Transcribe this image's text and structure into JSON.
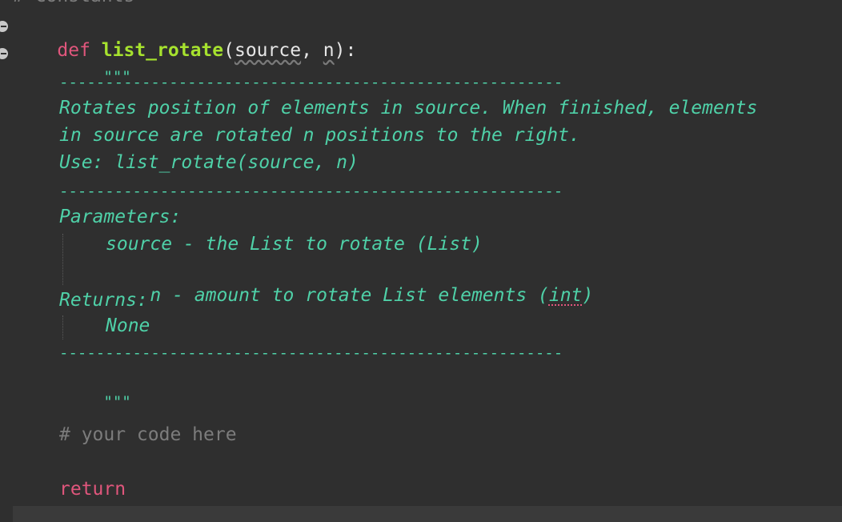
{
  "editor": {
    "top_partial_comment": "# Constants",
    "def_keyword": "def",
    "function_name": "list_rotate",
    "open_paren": "(",
    "param_source": "source",
    "comma": ", ",
    "param_n": "n",
    "close_paren": "):",
    "docstring_open": "\"\"\"",
    "separator": "-------------------------------------------------------",
    "description_line1": "Rotates position of elements in source. When finished, elements",
    "description_line2": "in source are rotated n positions to the right.",
    "use_line": "Use: list_rotate(source, n)",
    "parameters_heading": "Parameters:",
    "param1_desc": "source - the List to rotate (List)",
    "param2_desc_prefix": "n - amount to rotate List elements (",
    "param2_type": "int",
    "param2_desc_suffix": ")",
    "returns_heading": "Returns:",
    "returns_value": "None",
    "docstring_close": "\"\"\"",
    "code_comment": "# your code here",
    "return_keyword": "return"
  },
  "colors": {
    "background": "#2f2f2f",
    "keyword": "#e0567c",
    "function_name": "#a6e22e",
    "docstring": "#4fd1a8",
    "comment": "#7c7c7c",
    "text": "#e6e6e6"
  }
}
